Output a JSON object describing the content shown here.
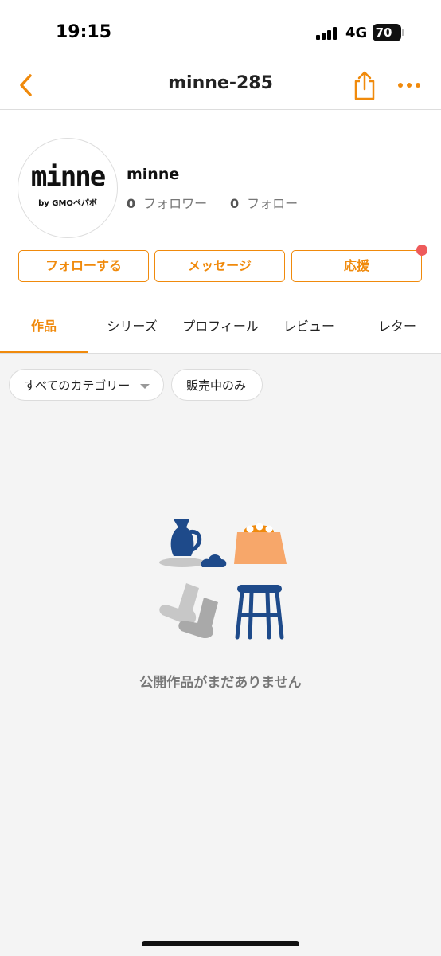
{
  "status_bar": {
    "time": "19:15",
    "network": "4G",
    "battery": "70"
  },
  "nav": {
    "title": "minne-285",
    "back_icon": "chevron-left-icon",
    "share_icon": "share-icon",
    "more_icon": "more-icon"
  },
  "profile": {
    "avatar_logo": "minne",
    "avatar_sub": "by GMOペパボ",
    "name": "minne",
    "followers": {
      "count": "0",
      "label": "フォロワー"
    },
    "following": {
      "count": "0",
      "label": "フォロー"
    },
    "buttons": {
      "follow": "フォローする",
      "message": "メッセージ",
      "support": "応援"
    }
  },
  "tabs": [
    {
      "label": "作品"
    },
    {
      "label": "シリーズ"
    },
    {
      "label": "プロフィール"
    },
    {
      "label": "レビュー"
    },
    {
      "label": "レター"
    }
  ],
  "filters": {
    "category": "すべてのカテゴリー",
    "sale": "販売中のみ"
  },
  "empty_state": {
    "message": "公開作品がまだありません"
  },
  "colors": {
    "accent": "#f08a0c",
    "badge": "#ee5b5b",
    "background": "#f4f4f4",
    "illustration_blue": "#1e4a8a",
    "illustration_orange": "#f7a76a"
  }
}
